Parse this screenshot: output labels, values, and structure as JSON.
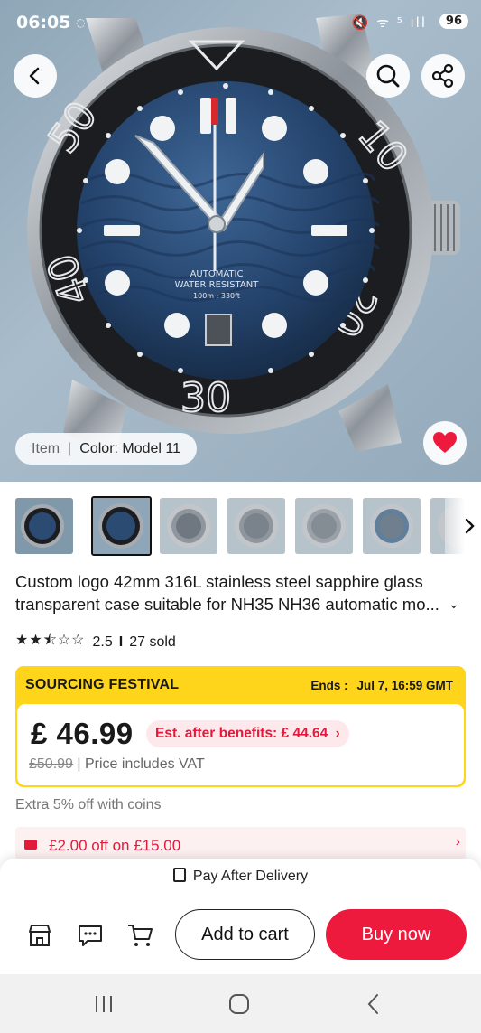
{
  "status_bar": {
    "time": "06:05",
    "icons": "🔇 ᯤ ⁵ ıll",
    "battery": "96"
  },
  "hero": {
    "variant_label_key": "Item",
    "variant_label_value": "Color: Model 11",
    "favorited": true,
    "watch_dial_text": [
      "AUTOMATIC",
      "WATER RESISTANT",
      "100m : 330ft"
    ],
    "bezel_numbers": [
      "10",
      "20",
      "30",
      "40",
      "50"
    ]
  },
  "thumbnails": {
    "selected_index": 1,
    "count_visible": 7
  },
  "product": {
    "title": "Custom logo 42mm 316L stainless steel sapphire glass transparent case suitable for NH35 NH36 automatic mo...",
    "rating": "2.5",
    "rating_stars": 2.5,
    "sold": "27 sold"
  },
  "promo": {
    "heading": "SOURCING FESTIVAL",
    "ends_label": "Ends :",
    "ends_value": "Jul 7, 16:59 GMT",
    "price": "£ 46.99",
    "est_label": "Est. after benefits: £ 44.64",
    "old_price": "£50.99",
    "vat_note": "| Price includes VAT"
  },
  "coins_note": "Extra 5% off with coins",
  "coupon": {
    "text": "£2.00 off on £15.00"
  },
  "bottom_bar": {
    "pay_after_delivery": "Pay After Delivery",
    "add_to_cart": "Add to cart",
    "buy_now": "Buy now"
  },
  "colors": {
    "accent": "#ee1a3e",
    "promo_yellow": "#ffd51c",
    "coupon_bg": "#fdf0f1"
  }
}
